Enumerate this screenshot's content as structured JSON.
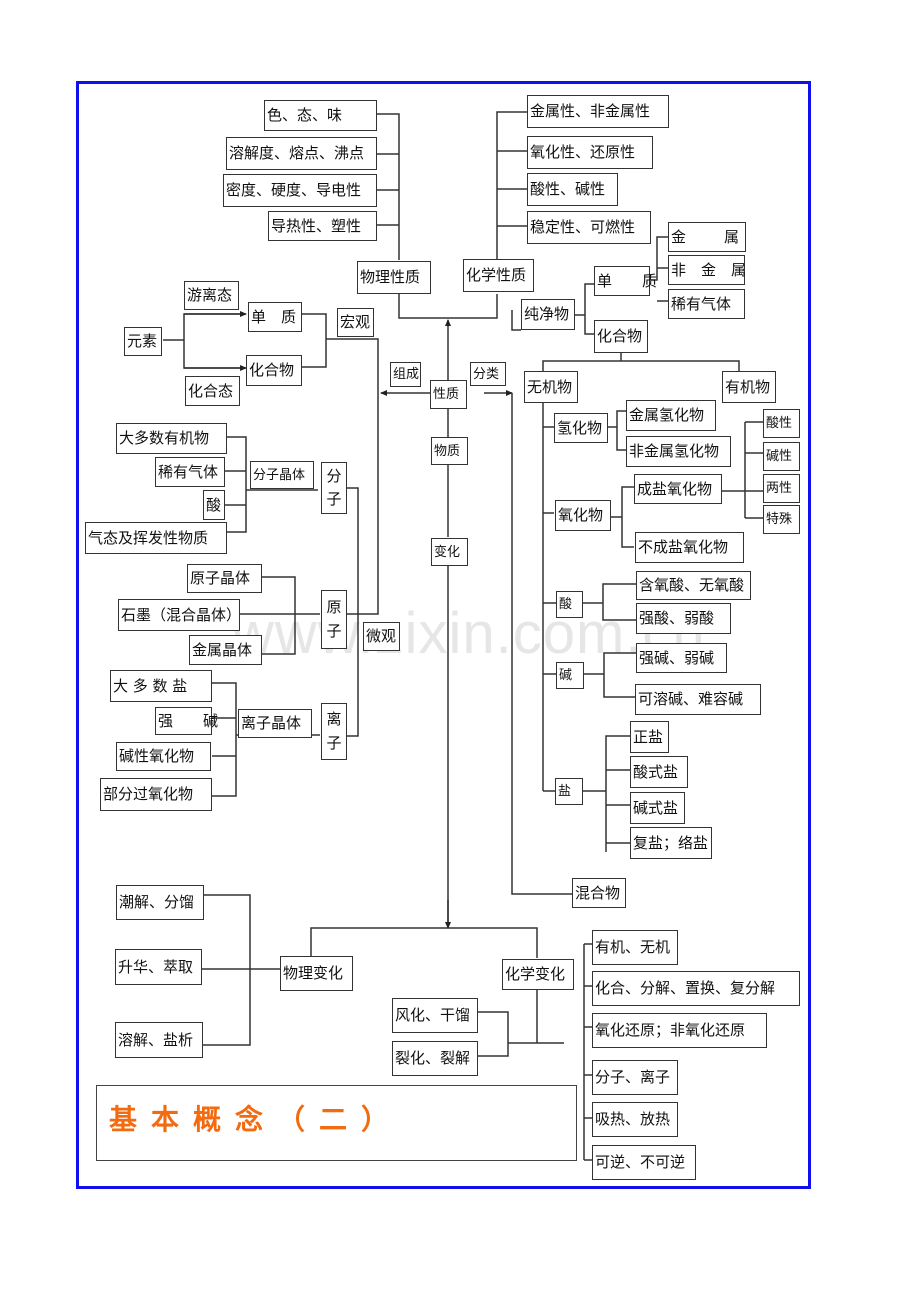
{
  "title": "基本概念（二）",
  "watermark": "www.zixin.com.cn",
  "colors": {
    "frame": "#1010ee",
    "title": "#f26b11",
    "line": "#333333"
  },
  "center": {
    "property": "性质",
    "substance": "物质",
    "change": "变化",
    "composition": "组成",
    "classification": "分类"
  },
  "physical_properties": {
    "label": "物理性质",
    "items": [
      "色、态、味",
      "溶解度、熔点、沸点",
      "密度、硬度、导电性",
      "导热性、塑性"
    ]
  },
  "chemical_properties": {
    "label": "化学性质",
    "items": [
      "金属性、非金属性",
      "氧化性、还原性",
      "酸性、碱性",
      "稳定性、可燃性"
    ]
  },
  "composition": {
    "macro": "宏观",
    "micro": "微观",
    "element": "元素",
    "free_state": "游离态",
    "combined_state": "化合态",
    "simple_substance": "单　质",
    "compound": "化合物",
    "molecule": [
      "分",
      "子"
    ],
    "atom": [
      "原",
      "子"
    ],
    "ion": [
      "离",
      "子"
    ],
    "molecular_crystal": {
      "label": "分子晶体",
      "items": [
        "大多数有机物",
        "稀有气体",
        "酸",
        "气态及挥发性物质"
      ]
    },
    "atomic_crystal": {
      "items": [
        "原子晶体",
        "石墨（混合晶体）",
        "金属晶体"
      ]
    },
    "ionic_crystal": {
      "label": "离子晶体",
      "items": [
        "大 多 数 盐",
        "强　　碱",
        "碱性氧化物",
        "部分过氧化物"
      ]
    }
  },
  "classification": {
    "pure": "纯净物",
    "mixture": "混合物",
    "simple": {
      "label": "单　　质",
      "items": [
        "金",
        "属",
        "非　金　属",
        "稀有气体"
      ]
    },
    "compound": "化合物",
    "inorganic": "无机物",
    "organic": "有机物",
    "hydride": {
      "label": "氢化物",
      "items": [
        "金属氢化物",
        "非金属氢化物"
      ]
    },
    "oxide": {
      "label": "氧化物",
      "salt_forming": "成盐氧化物",
      "non_salt_forming": "不成盐氧化物",
      "kinds": [
        "酸性",
        "碱性",
        "两性",
        "特殊"
      ]
    },
    "acid": {
      "label": "酸",
      "items": [
        "含氧酸、无氧酸",
        "强酸、弱酸"
      ]
    },
    "base": {
      "label": "碱",
      "items": [
        "强碱、弱碱",
        "可溶碱、难容碱"
      ]
    },
    "salt": {
      "label": "盐",
      "items": [
        "正盐",
        "酸式盐",
        "碱式盐",
        "复盐；络盐"
      ]
    }
  },
  "change": {
    "physical": {
      "label": "物理变化",
      "items": [
        "潮解、分馏",
        "升华、萃取",
        "溶解、盐析"
      ]
    },
    "chemical": {
      "label": "化学变化",
      "examples": [
        "风化、干馏",
        "裂化、裂解"
      ],
      "types": [
        "有机、无机",
        "化合、分解、置换、复分解",
        "氧化还原；非氧化还原",
        "分子、离子",
        "吸热、放热",
        "可逆、不可逆"
      ]
    }
  }
}
